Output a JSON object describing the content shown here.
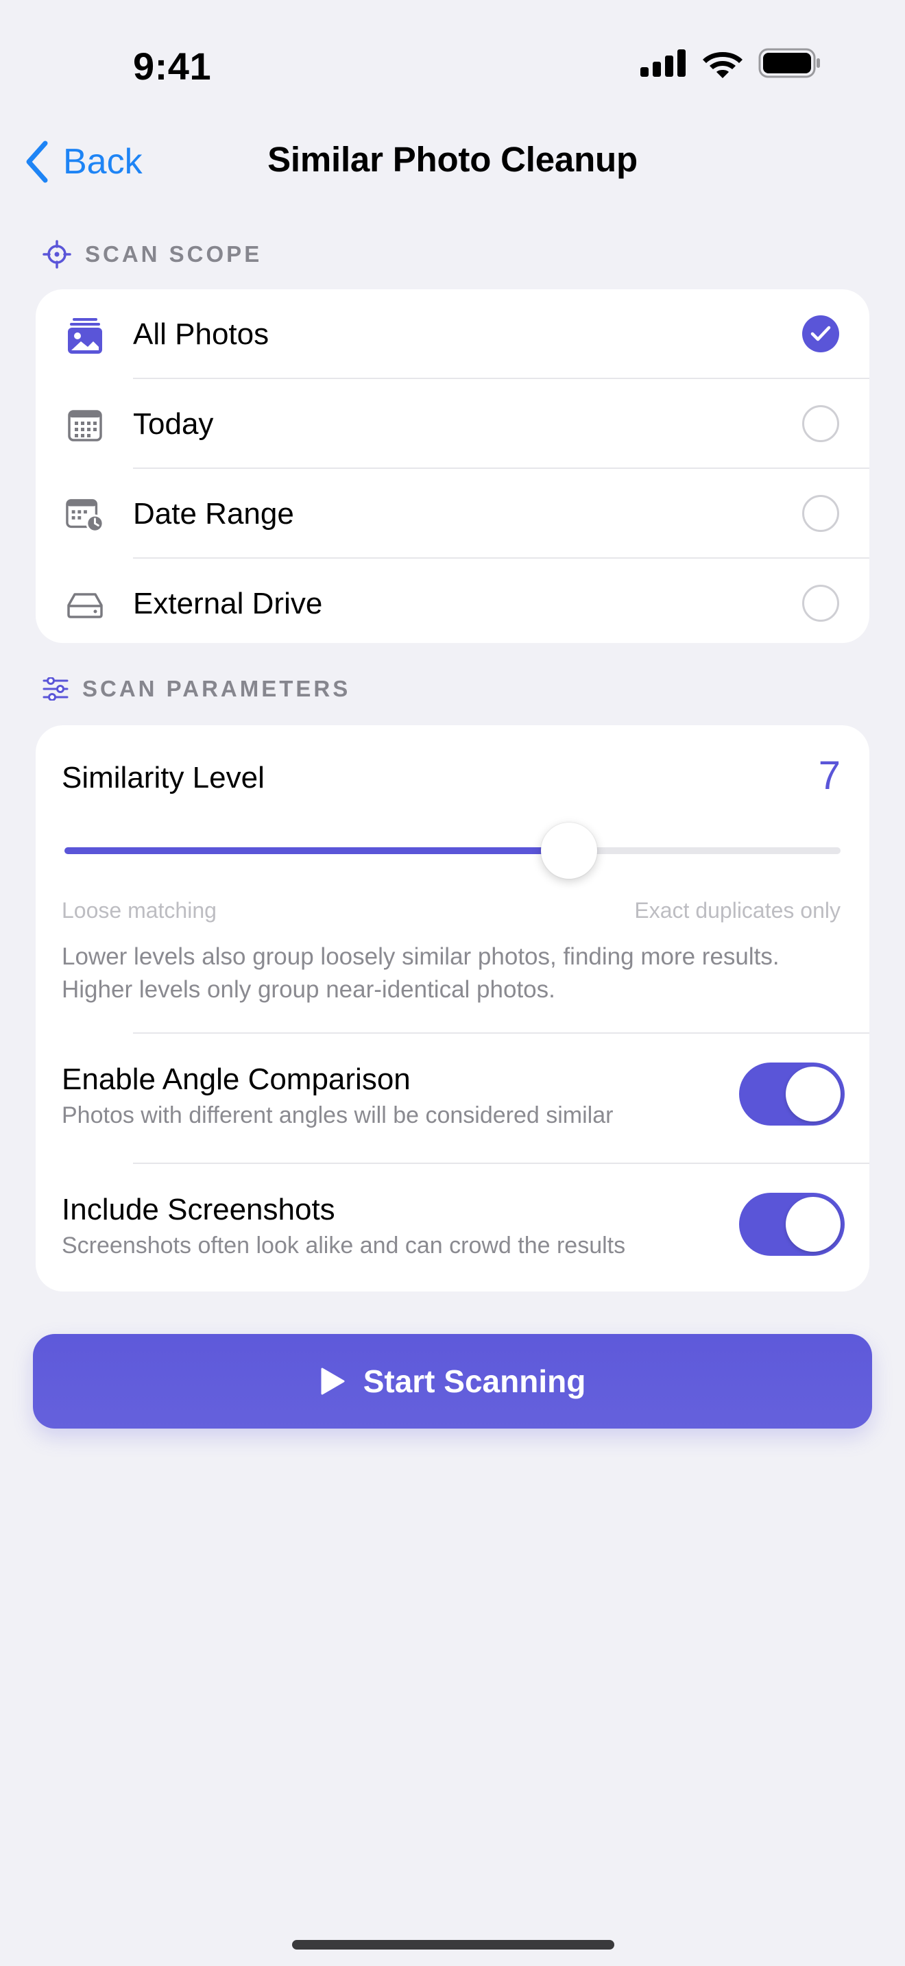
{
  "status_bar": {
    "time": "9:41"
  },
  "nav": {
    "back_label": "Back",
    "title": "Similar Photo Cleanup"
  },
  "scope": {
    "header": "SCAN SCOPE",
    "items": [
      {
        "label": "All Photos",
        "icon": "photo-stack-icon",
        "selected": true
      },
      {
        "label": "Today",
        "icon": "calendar-icon",
        "selected": false
      },
      {
        "label": "Date Range",
        "icon": "calendar-clock-icon",
        "selected": false
      },
      {
        "label": "External Drive",
        "icon": "external-drive-icon",
        "selected": false
      }
    ]
  },
  "params": {
    "header": "SCAN PARAMETERS",
    "similarity": {
      "title": "Similarity Level",
      "value": "7",
      "fraction": 0.65,
      "min_label": "Loose matching",
      "max_label": "Exact duplicates only",
      "description": "Lower levels also group loosely similar photos, finding more results. Higher levels only group near-identical photos."
    },
    "angle": {
      "title": "Enable Angle Comparison",
      "subtitle": "Photos with different angles will be considered similar",
      "enabled": true
    },
    "screenshots": {
      "title": "Include Screenshots",
      "subtitle": "Screenshots often look alike and can crowd the results",
      "enabled": true
    }
  },
  "primary_button": {
    "label": "Start Scanning"
  },
  "colors": {
    "accent": "#5A55D8",
    "link": "#1E84F5",
    "background": "#F1F1F6"
  }
}
